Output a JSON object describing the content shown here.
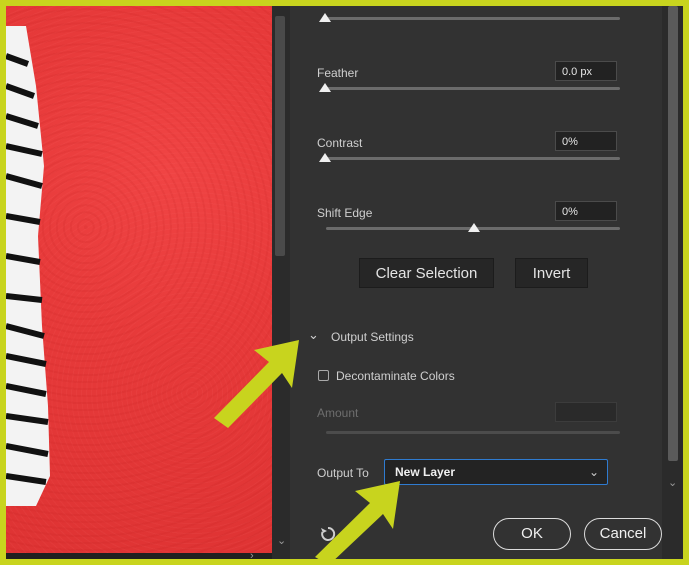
{
  "panel": {
    "feather": {
      "label": "Feather",
      "value": "0.0 px"
    },
    "contrast": {
      "label": "Contrast",
      "value": "0%"
    },
    "shift_edge": {
      "label": "Shift Edge",
      "value": "0%"
    },
    "clear_selection": "Clear Selection",
    "invert": "Invert",
    "output_settings": "Output Settings",
    "decontaminate": "Decontaminate Colors",
    "amount": "Amount",
    "output_to_label": "Output To",
    "output_to_value": "New Layer",
    "ok": "OK",
    "cancel": "Cancel"
  },
  "icons": [
    "chevron-down-icon",
    "caret-down-icon",
    "reset-icon",
    "highlight-arrow-icon"
  ],
  "colors": {
    "accent": "#c8d41e",
    "mask_overlay": "#e73a3a",
    "panel_bg": "#323232",
    "focus_border": "#2f7bd0"
  }
}
